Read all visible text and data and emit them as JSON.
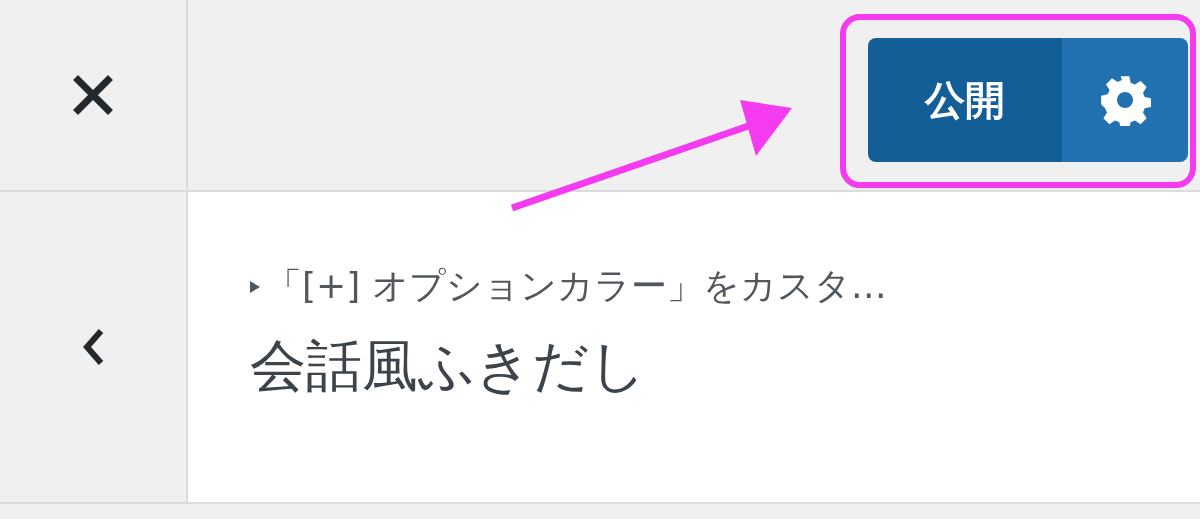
{
  "header": {
    "publish_button": {
      "label": "公開"
    }
  },
  "panel": {
    "breadcrumb": "「[+] オプションカラー」をカスタ…",
    "title": "会話風ふきだし"
  }
}
